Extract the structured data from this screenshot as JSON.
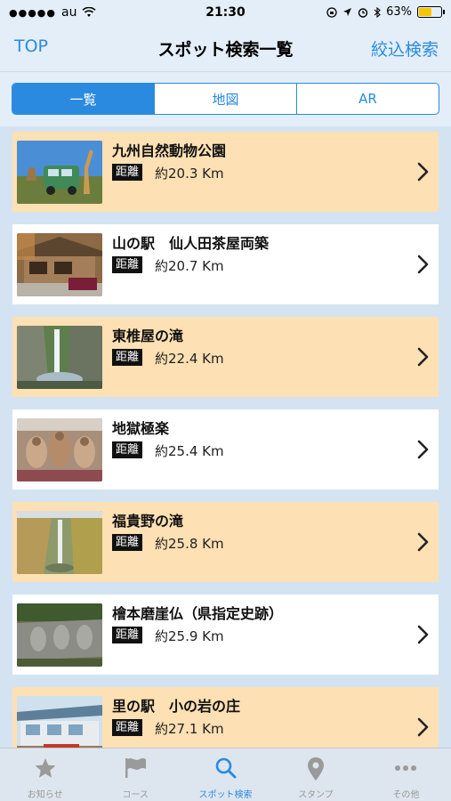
{
  "status_bar": {
    "signal": "●●●●●",
    "carrier": "au",
    "time": "21:30",
    "battery_text": "63%",
    "battery_level": 0.63
  },
  "nav": {
    "left_label": "TOP",
    "title": "スポット検索一覧",
    "right_label": "絞込検索"
  },
  "segments": [
    {
      "label": "一覧",
      "active": true
    },
    {
      "label": "地図",
      "active": false
    },
    {
      "label": "AR",
      "active": false
    }
  ],
  "distance_tag": "距離",
  "spots": [
    {
      "name": "九州自然動物公園",
      "distance": "約20.3 Km",
      "thumb": "safari"
    },
    {
      "name": "山の駅　仙人田茶屋両築",
      "distance": "約20.7 Km",
      "thumb": "teahouse"
    },
    {
      "name": "東椎屋の滝",
      "distance": "約22.4 Km",
      "thumb": "waterfall"
    },
    {
      "name": "地獄極楽",
      "distance": "約25.4 Km",
      "thumb": "cave"
    },
    {
      "name": "福貴野の滝",
      "distance": "約25.8 Km",
      "thumb": "waterfall2"
    },
    {
      "name": "檜本磨崖仏（県指定史跡）",
      "distance": "約25.9 Km",
      "thumb": "rock"
    },
    {
      "name": "里の駅　小の岩の庄",
      "distance": "約27.1 Km",
      "thumb": "station"
    }
  ],
  "tabs": [
    {
      "label": "お知らせ",
      "icon": "star-icon",
      "active": false
    },
    {
      "label": "コース",
      "icon": "flag-icon",
      "active": false
    },
    {
      "label": "スポット検索",
      "icon": "search-icon",
      "active": true
    },
    {
      "label": "スタンプ",
      "icon": "pin-icon",
      "active": false
    },
    {
      "label": "その他",
      "icon": "more-icon",
      "active": false
    }
  ],
  "colors": {
    "accent": "#2a8ae0",
    "row_highlight": "#fde0b3",
    "row_plain": "#ffffff",
    "background": "#d4e3f1"
  }
}
